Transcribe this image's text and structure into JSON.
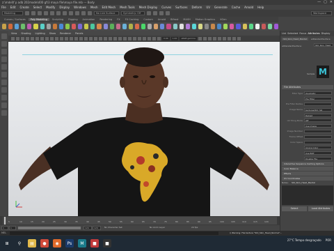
{
  "window": {
    "title": "z:\\mdel\\f p adb 202mode\\400 gf\\3 maya file\\maya file.mb --- Body",
    "controls": [
      "—",
      "▢",
      "✕"
    ]
  },
  "menubar": [
    "File",
    "Edit",
    "Create",
    "Select",
    "Modify",
    "Display",
    "Windows",
    "Mesh",
    "Edit Mesh",
    "Mesh Tools",
    "Mesh Display",
    "Curves",
    "Surfaces",
    "Deform",
    "UV",
    "Generate",
    "Cache",
    "Arnold",
    "Help"
  ],
  "status_line": {
    "mode": "Modeling",
    "no_live_surface": "No Live Surface",
    "symmetry": "Symmetry: Off",
    "workspace": "Workspace"
  },
  "shelf": {
    "tabs": [
      "Curves / Surfaces",
      "Poly Modeling",
      "Sculpting",
      "Rigging",
      "Animation",
      "Rendering",
      "FX",
      "FX Caching",
      "Custom",
      "Arnold",
      "Bifrost",
      "MASH",
      "Motion Graphics",
      "XGen"
    ],
    "active_tab_index": 1,
    "icon_colors": [
      "#c8a24a",
      "#d26a3a",
      "#5aa0d8",
      "#6cbf6c",
      "#c05ab0",
      "#d8d24a",
      "#5ad0c8",
      "#a0a0a0",
      "#c87a3a",
      "#4a8ad8",
      "#8ac84a",
      "#d85a5a",
      "#7a6ad8",
      "#c8c84a",
      "#4ac8a0",
      "#d8884a",
      "#8888d8",
      "#5ab05a",
      "#c86a8a",
      "#6ab0d8",
      "#b0b04a",
      "#d86a4a",
      "#4ad86a",
      "#aaaaaa",
      "#d8a06a",
      "#6a8ad8",
      "#c84a88",
      "#88c8c8",
      "#e0e0e0",
      "#b07ad8",
      "#5ad8d8",
      "#d8d888",
      "#888888",
      "#c8884a",
      "#4a88c8",
      "#a0d85a",
      "#d85aa0",
      "#5a5ad8",
      "#d8c05a",
      "#5ad88a",
      "#f0f0f0",
      "#c85a5a",
      "#7ad8a0",
      "#a05ad8"
    ]
  },
  "panel": {
    "menu": [
      "View",
      "Shading",
      "Lighting",
      "Show",
      "Renderer",
      "Panels"
    ],
    "toolbar_fields": [
      "0.00",
      "1.00",
      "sRGB gamma"
    ]
  },
  "attribute_editor": {
    "tabs": [
      "List",
      "Selected",
      "Focus",
      "Attributes",
      "Display"
    ],
    "active_tab_index": 3,
    "node_tabs": [
      "Std_Skin_Head_Mental",
      "aiStandardSurface"
    ],
    "node_label": "aiStandardSurface:",
    "node_value": "Std_Skin_Head",
    "sample_label": "Sample",
    "section_file": "File Attributes",
    "rows": [
      {
        "label": "Filter Type",
        "value": "Quadratic"
      },
      {
        "label": "",
        "value": "Pre Filter"
      },
      {
        "label": "Pre Filter Radius",
        "value": ""
      },
      {
        "label": "Image Name",
        "value": "textures/Std_Ski"
      },
      {
        "label": "",
        "value": "Reload"
      },
      {
        "label": "UV Tiling Mode",
        "value": "Off"
      },
      {
        "label": "",
        "value": "Use Image"
      },
      {
        "label": "Image Number",
        "value": ""
      },
      {
        "label": "Frame Offset",
        "value": ""
      },
      {
        "label": "Color Space",
        "value": ""
      },
      {
        "label": "",
        "value": "Ignore Color"
      },
      {
        "label": "",
        "value": "Use BOT"
      },
      {
        "label": "",
        "value": "Disable File"
      }
    ],
    "collapsed_sections": [
      "Interactive Sequence Caching Options",
      "Color Balance",
      "Effects",
      "UV Coordinates"
    ],
    "notes_label": "Notes:",
    "notes_value": "Std_Skin_Head_Mental",
    "buttons": {
      "select": "Select",
      "load": "Load Attributes"
    }
  },
  "range_slider": {
    "fields": [
      "1",
      "1",
      "1",
      "120",
      "120",
      "200"
    ]
  },
  "time_slider": {
    "ticks": [
      "5",
      "10",
      "15",
      "20",
      "25",
      "30",
      "35",
      "40",
      "45",
      "50",
      "55",
      "60",
      "65",
      "70",
      "75",
      "80",
      "85",
      "90",
      "95",
      "100",
      "105",
      "110",
      "115",
      "120"
    ],
    "current_frame": "1",
    "no_character_set": "No Character Set",
    "no_anim_layer": "No Anim Layer",
    "fps": "24 fps"
  },
  "command_line": {
    "label": "MEL",
    "message": "// Warning: File texture \"Std_Skin_Head_Normal\"..."
  },
  "taskbar": {
    "apps": [
      {
        "name": "windows-start",
        "color": "#1f2a35",
        "glyph": "⊞"
      },
      {
        "name": "search",
        "color": "#1f2a35",
        "glyph": "⚲"
      },
      {
        "name": "file-explorer",
        "color": "#e0b84a",
        "glyph": "▤"
      },
      {
        "name": "chrome",
        "color": "#d04a3a",
        "glyph": "●"
      },
      {
        "name": "firefox",
        "color": "#e06a2a",
        "glyph": "◉"
      },
      {
        "name": "photoshop",
        "color": "#1a3a6a",
        "glyph": "Ps"
      },
      {
        "name": "maya",
        "color": "#1a7a8a",
        "glyph": "M"
      },
      {
        "name": "app-red",
        "color": "#c03a3a",
        "glyph": "■"
      },
      {
        "name": "app-dark",
        "color": "#333",
        "glyph": "■"
      }
    ],
    "weather": "27°C  Tempo desgraçado",
    "time": "",
    "lang": "POR"
  }
}
